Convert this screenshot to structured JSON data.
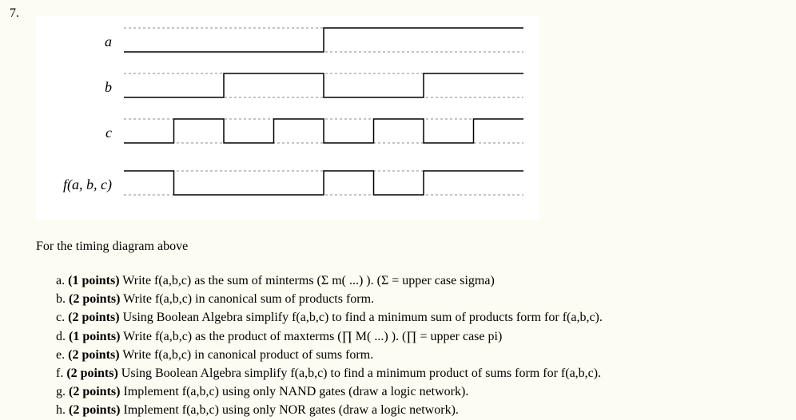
{
  "question_number": "7.",
  "labels": {
    "a": "a",
    "b": "b",
    "c": "c",
    "f": "f(a, b, c)"
  },
  "intro": "For the timing diagram above",
  "parts": {
    "a": {
      "label": "a.",
      "points": "(1 points)",
      "text": " Write f(a,b,c) as the sum of minterms (Σ m( ...) ).    (Σ = upper case sigma)"
    },
    "b": {
      "label": "b.",
      "points": "(2 points)",
      "text": " Write f(a,b,c) in canonical sum of products form."
    },
    "c": {
      "label": "c.",
      "points": "(2 points)",
      "text": " Using Boolean Algebra simplify f(a,b,c) to find a minimum sum of products form for f(a,b,c)."
    },
    "d": {
      "label": "d.",
      "points": "(1 points)",
      "text": " Write f(a,b,c) as the product of maxterms (∏ M( ...) ).    (∏ = upper case pi)"
    },
    "e": {
      "label": "e.",
      "points": "(2 points)",
      "text": " Write f(a,b,c) in canonical product of sums form."
    },
    "f": {
      "label": "f.",
      "points": "(2 points)",
      "text": " Using Boolean Algebra simplify f(a,b,c) to find a minimum product of sums form for f(a,b,c)."
    },
    "g": {
      "label": "g.",
      "points": "(2 points)",
      "text": " Implement f(a,b,c) using only NAND gates (draw a logic network)."
    },
    "h": {
      "label": "h.",
      "points": "(2 points)",
      "text": " Implement f(a,b,c) using only NOR gates (draw a logic network)."
    }
  },
  "chart_data": {
    "type": "timing_diagram",
    "time_slots": 8,
    "signals": [
      {
        "name": "a",
        "values": [
          0,
          0,
          0,
          0,
          1,
          1,
          1,
          1
        ]
      },
      {
        "name": "b",
        "values": [
          0,
          0,
          1,
          1,
          0,
          0,
          1,
          1
        ]
      },
      {
        "name": "c",
        "values": [
          0,
          1,
          0,
          1,
          0,
          1,
          0,
          1
        ]
      },
      {
        "name": "f(a,b,c)",
        "values": [
          1,
          0,
          0,
          0,
          1,
          0,
          1,
          1
        ]
      }
    ]
  }
}
